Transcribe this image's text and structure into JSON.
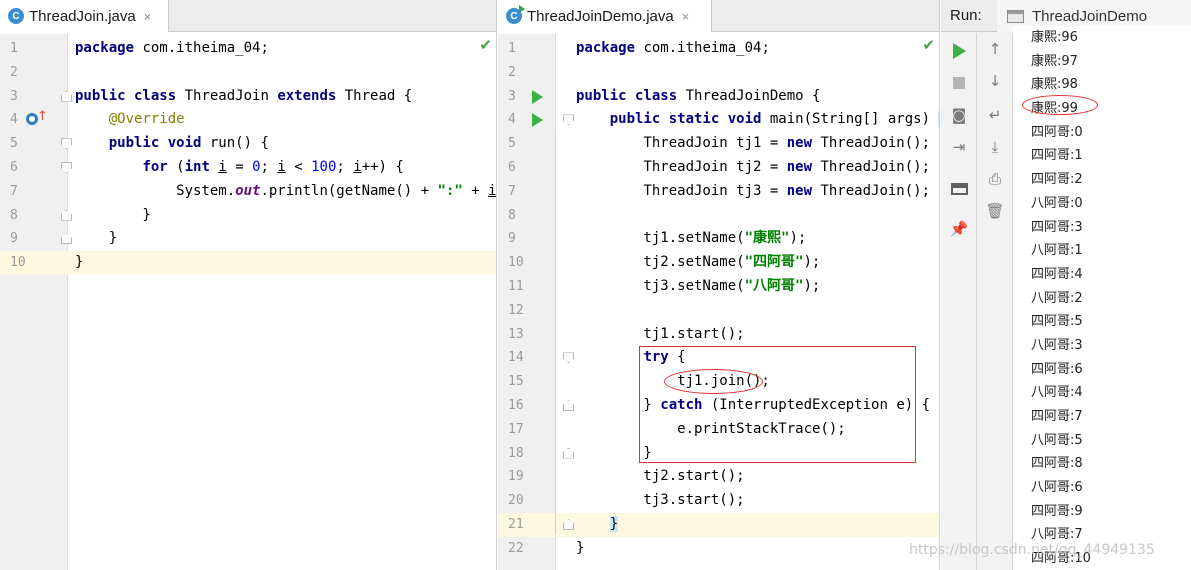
{
  "left_editor": {
    "tab": {
      "icon": "class-icon",
      "icon_letter": "C",
      "label": "ThreadJoin.java",
      "close": "×"
    },
    "lines": [
      {
        "n": "1",
        "html": "<span class=\"kw\">package</span> com.itheima_04;"
      },
      {
        "n": "2",
        "html": ""
      },
      {
        "n": "3",
        "html": "<span class=\"kw\">public class</span> ThreadJoin <span class=\"kw\">extends</span> Thread {"
      },
      {
        "n": "4",
        "html": "    <span class=\"ann\">@Override</span>"
      },
      {
        "n": "5",
        "html": "    <span class=\"kw\">public void</span> run() {"
      },
      {
        "n": "6",
        "html": "        <span class=\"kw\">for</span> (<span class=\"kw\">int</span> <span class=\"ul\">i</span> = <span class=\"num\">0</span>; <span class=\"ul\">i</span> &lt; <span class=\"num\">100</span>; <span class=\"ul\">i</span>++) {"
      },
      {
        "n": "7",
        "html": "            System.<span class=\"stat\">out</span>.println(getName() + <span class=\"str\">\":\"</span> + <span class=\"ul\">i</span>);"
      },
      {
        "n": "8",
        "html": "        }"
      },
      {
        "n": "9",
        "html": "    }"
      },
      {
        "n": "10",
        "html": "}"
      }
    ]
  },
  "right_editor": {
    "tab": {
      "icon": "class-run-icon",
      "icon_letter": "C",
      "label": "ThreadJoinDemo.java",
      "close": "×"
    },
    "lines": [
      {
        "n": "1",
        "html": "<span class=\"kw\">package</span> com.itheima_04;"
      },
      {
        "n": "2",
        "html": ""
      },
      {
        "n": "3",
        "html": "<span class=\"kw\">public class</span> ThreadJoinDemo {"
      },
      {
        "n": "4",
        "html": "    <span class=\"kw\">public static void</span> main(String[] args) <span class=\"brace-hl\">{</span>"
      },
      {
        "n": "5",
        "html": "        ThreadJoin tj1 = <span class=\"kw\">new</span> ThreadJoin();"
      },
      {
        "n": "6",
        "html": "        ThreadJoin tj2 = <span class=\"kw\">new</span> ThreadJoin();"
      },
      {
        "n": "7",
        "html": "        ThreadJoin tj3 = <span class=\"kw\">new</span> ThreadJoin();"
      },
      {
        "n": "8",
        "html": ""
      },
      {
        "n": "9",
        "html": "        tj1.setName(<span class=\"str\">\"康熙\"</span>);"
      },
      {
        "n": "10",
        "html": "        tj2.setName(<span class=\"str\">\"四阿哥\"</span>);"
      },
      {
        "n": "11",
        "html": "        tj3.setName(<span class=\"str\">\"八阿哥\"</span>);"
      },
      {
        "n": "12",
        "html": ""
      },
      {
        "n": "13",
        "html": "        tj1.start();"
      },
      {
        "n": "14",
        "html": "        <span class=\"kw\">try</span> {"
      },
      {
        "n": "15",
        "html": "            tj1.join();"
      },
      {
        "n": "16",
        "html": "        } <span class=\"kw\">catch</span> (InterruptedException e) {"
      },
      {
        "n": "17",
        "html": "            e.printStackTrace();"
      },
      {
        "n": "18",
        "html": "        }"
      },
      {
        "n": "19",
        "html": "        tj2.start();"
      },
      {
        "n": "20",
        "html": "        tj3.start();"
      },
      {
        "n": "21",
        "html": "    <span class=\"brace-hl\">}</span>"
      },
      {
        "n": "22",
        "html": "}"
      }
    ]
  },
  "run_panel": {
    "label": "Run:",
    "config_name": "ThreadJoinDemo",
    "output": [
      "康熙:96",
      "康熙:97",
      "康熙:98",
      "康熙:99",
      "四阿哥:0",
      "四阿哥:1",
      "四阿哥:2",
      "八阿哥:0",
      "四阿哥:3",
      "八阿哥:1",
      "四阿哥:4",
      "八阿哥:2",
      "四阿哥:5",
      "八阿哥:3",
      "四阿哥:6",
      "八阿哥:4",
      "四阿哥:7",
      "八阿哥:5",
      "四阿哥:8",
      "八阿哥:6",
      "四阿哥:9",
      "八阿哥:7",
      "四阿哥:10"
    ]
  },
  "watermark": "https://blog.csdn.net/qq_44949135"
}
